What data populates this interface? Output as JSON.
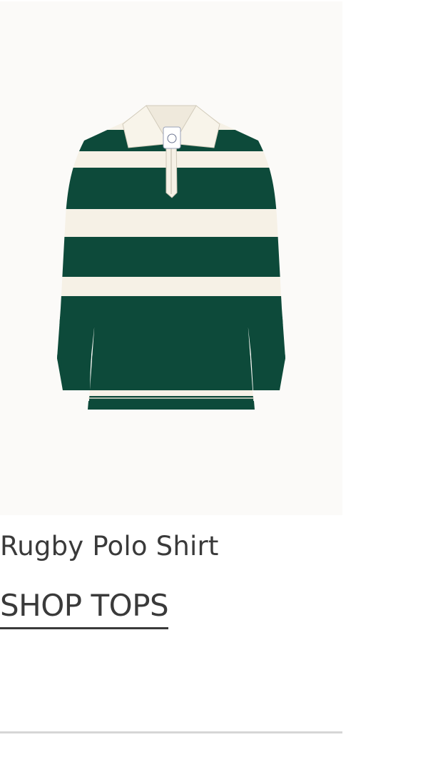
{
  "product": {
    "name": "Rugby Polo Shirt",
    "image_alt": "Rugby Polo Shirt",
    "stripe_colors": {
      "primary": "#0d4a3a",
      "secondary": "#f6f1e6"
    }
  },
  "cta": {
    "label": "SHOP TOPS"
  }
}
